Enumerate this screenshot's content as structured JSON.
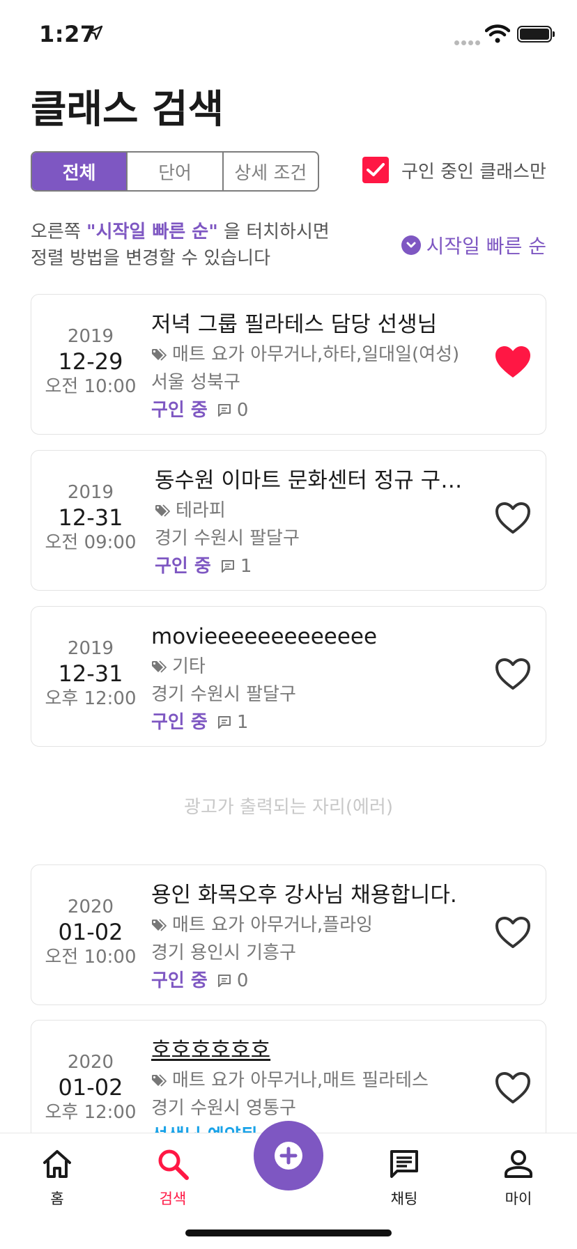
{
  "status_bar": {
    "time": "1:27"
  },
  "page_title": "클래스 검색",
  "segments": [
    "전체",
    "단어",
    "상세 조건"
  ],
  "only_recruiting_label": "구인 중인 클래스만",
  "hint": {
    "prefix": "오른쪽 ",
    "highlight": "\"시작일 빠른 순\"",
    "suffix": " 을 터치하시면",
    "line2": "정렬 방법을 변경할 수 있습니다"
  },
  "sort_label": "시작일 빠른 순",
  "listings": [
    {
      "year": "2019",
      "date": "12-29",
      "time": "오전 10:00",
      "title": "저녁 그룹 필라테스 담당 선생님",
      "tags": "매트 요가 아무거나,하타,일대일(여성)",
      "location": "서울 성북구",
      "status": "구인 중",
      "comments": "0",
      "liked": true
    },
    {
      "year": "2019",
      "date": "12-31",
      "time": "오전 09:00",
      "title": "동수원 이마트 문화센터 정규 구인합니다",
      "tags": "테라피",
      "location": "경기 수원시 팔달구",
      "status": "구인 중",
      "comments": "1",
      "liked": false
    },
    {
      "year": "2019",
      "date": "12-31",
      "time": "오후 12:00",
      "title": "movieeeeeeeeeeeee",
      "tags": "기타",
      "location": "경기 수원시 팔달구",
      "status": "구인 중",
      "comments": "1",
      "liked": false
    },
    {
      "year": "2020",
      "date": "01-02",
      "time": "오전 10:00",
      "title": "용인 화목오후 강사님 채용합니다.",
      "tags": "매트 요가 아무거나,플라잉",
      "location": "경기 용인시 기흥구",
      "status": "구인 중",
      "comments": "0",
      "liked": false
    },
    {
      "year": "2020",
      "date": "01-02",
      "time": "오후 12:00",
      "title": "호호호호호호",
      "tags": "매트 요가 아무거나,매트 필라테스",
      "location": "경기 수원시 영통구",
      "status": "선생님 예약됨",
      "comments": "",
      "liked": false
    }
  ],
  "ad_placeholder": "광고가 출력되는 자리(에러)",
  "tabbar": {
    "home": "홈",
    "search": "검색",
    "chat": "채팅",
    "my": "마이"
  },
  "colors": {
    "accent": "#7e57c2",
    "like": "#ff1744",
    "reserved": "#1aa3e8"
  }
}
